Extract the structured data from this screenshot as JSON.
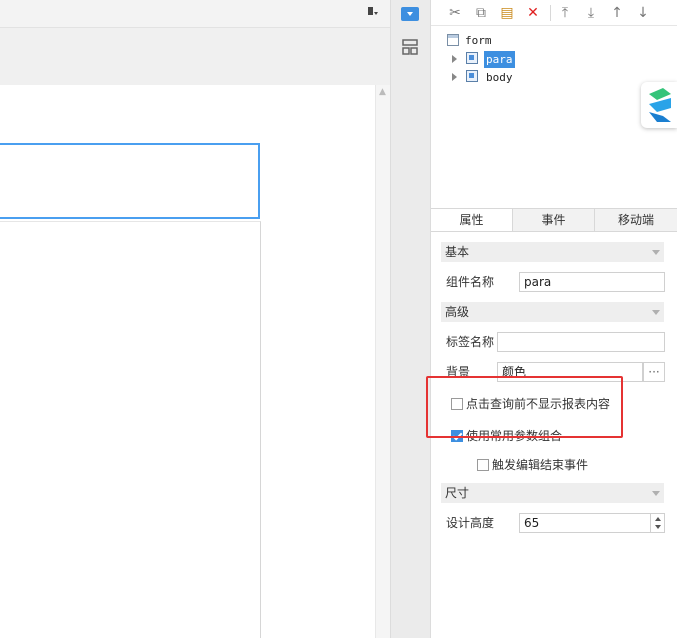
{
  "tree": {
    "root": "form",
    "children": [
      {
        "label": "para",
        "selected": true
      },
      {
        "label": "body",
        "selected": false
      }
    ]
  },
  "toolbar": {
    "icons": [
      "cut-icon",
      "copy-icon",
      "paste-icon",
      "delete-icon",
      "move-top-icon",
      "move-bottom-icon",
      "move-up-icon",
      "move-down-icon"
    ]
  },
  "tabs": [
    "属性",
    "事件",
    "移动端"
  ],
  "active_tab": "属性",
  "sections": {
    "basic": {
      "title": "基本",
      "component_name_label": "组件名称",
      "component_name_value": "para"
    },
    "advanced": {
      "title": "高级",
      "tag_name_label": "标签名称",
      "tag_name_value": "",
      "background_label": "背景",
      "background_value": "颜色",
      "more_label": "···",
      "hide_before_query_label": "点击查询前不显示报表内容",
      "hide_before_query_checked": false,
      "use_common_params_label": "使用常用参数组合",
      "use_common_params_checked": true,
      "trigger_edit_end_label": "触发编辑结束事件",
      "trigger_edit_end_checked": false
    },
    "size": {
      "title": "尺寸",
      "design_height_label": "设计高度",
      "design_height_value": "65"
    }
  },
  "colors": {
    "accent": "#3d8fe0",
    "highlight": "#e53333",
    "selection_border": "#4a9ff0"
  }
}
